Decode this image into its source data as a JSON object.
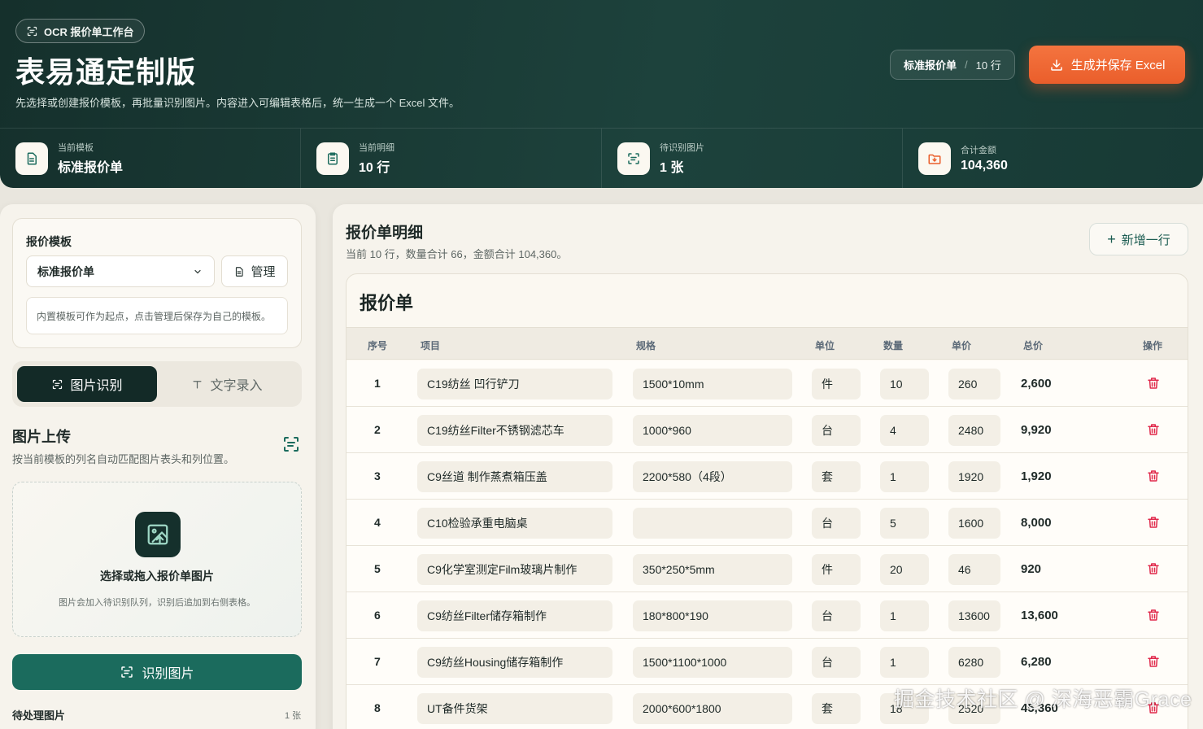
{
  "header": {
    "badge": "OCR 报价单工作台",
    "title": "表易通定制版",
    "subtitle": "先选择或创建报价模板，再批量识别图片。内容进入可编辑表格后，统一生成一个 Excel 文件。",
    "pill_template": "标准报价单",
    "pill_sep": "/",
    "pill_rows": "10 行",
    "generate_label": "生成并保存 Excel"
  },
  "stats": [
    {
      "label": "当前模板",
      "value": "标准报价单",
      "icon": "document-icon"
    },
    {
      "label": "当前明细",
      "value": "10 行",
      "icon": "clipboard-icon"
    },
    {
      "label": "待识别图片",
      "value": "1 张",
      "icon": "scan-icon"
    },
    {
      "label": "合计金额",
      "value": "104,360",
      "icon": "folder-icon"
    }
  ],
  "sidebar": {
    "template_title": "报价模板",
    "template_selected": "标准报价单",
    "manage_label": "管理",
    "template_note": "内置模板可作为起点，点击管理后保存为自己的模板。",
    "tabs": [
      {
        "label": "图片识别",
        "active": true
      },
      {
        "label": "文字录入",
        "active": false
      }
    ],
    "upload_title": "图片上传",
    "upload_sub": "按当前模板的列名自动匹配图片表头和列位置。",
    "dropzone_title": "选择或拖入报价单图片",
    "dropzone_sub": "图片会加入待识别队列，识别后追加到右侧表格。",
    "ocr_button": "识别图片",
    "pending_title": "待处理图片",
    "pending_count": "1 张"
  },
  "main": {
    "title": "报价单明细",
    "subtitle": "当前 10 行，数量合计 66，金额合计 104,360。",
    "add_row_label": "新增一行",
    "sheet_title": "报价单",
    "columns": [
      "序号",
      "项目",
      "规格",
      "单位",
      "数量",
      "单价",
      "总价",
      "操作"
    ],
    "rows": [
      {
        "no": "1",
        "item": "C19纺丝 凹行铲刀",
        "spec": "1500*10mm",
        "unit": "件",
        "qty": "10",
        "price": "260",
        "total": "2,600"
      },
      {
        "no": "2",
        "item": "C19纺丝Filter不锈钢滤芯车",
        "spec": "1000*960",
        "unit": "台",
        "qty": "4",
        "price": "2480",
        "total": "9,920"
      },
      {
        "no": "3",
        "item": "C9丝道 制作蒸煮箱压盖",
        "spec": "2200*580（4段）",
        "unit": "套",
        "qty": "1",
        "price": "1920",
        "total": "1,920"
      },
      {
        "no": "4",
        "item": "C10检验承重电脑桌",
        "spec": "",
        "unit": "台",
        "qty": "5",
        "price": "1600",
        "total": "8,000"
      },
      {
        "no": "5",
        "item": "C9化学室测定Film玻璃片制作",
        "spec": "350*250*5mm",
        "unit": "件",
        "qty": "20",
        "price": "46",
        "total": "920"
      },
      {
        "no": "6",
        "item": "C9纺丝Filter储存箱制作",
        "spec": "180*800*190",
        "unit": "台",
        "qty": "1",
        "price": "13600",
        "total": "13,600"
      },
      {
        "no": "7",
        "item": "C9纺丝Housing储存箱制作",
        "spec": "1500*1100*1000",
        "unit": "台",
        "qty": "1",
        "price": "6280",
        "total": "6,280"
      },
      {
        "no": "8",
        "item": "UT备件货架",
        "spec": "2000*600*1800",
        "unit": "套",
        "qty": "18",
        "price": "2520",
        "total": "45,360"
      }
    ]
  },
  "watermark": "掘金技术社区 @ 深海恶霸Grace",
  "colors": {
    "header_bg": "#15302c",
    "accent_orange": "#ea5e2b",
    "primary_green": "#1b6b5d",
    "delete_red": "#e0284a"
  }
}
